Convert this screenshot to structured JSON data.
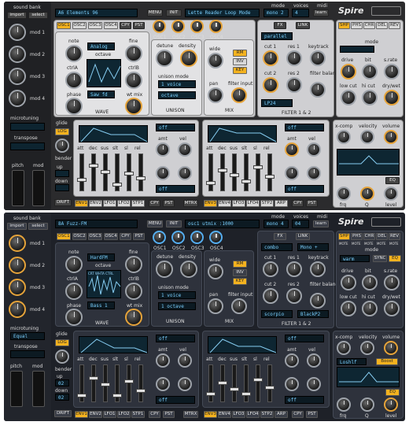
{
  "top": {
    "side": {
      "sound_bank": "sound bank",
      "import": "import",
      "select": "select",
      "mods": [
        "mod 1",
        "mod 2",
        "mod 3",
        "mod 4"
      ],
      "microtuning": "microtuning",
      "transpose": "transpose",
      "pitch": "pitch",
      "mod": "mod"
    },
    "header": {
      "patch": "A6 Elements 96",
      "menu": "MENU",
      "init": "INIT",
      "matrix": "Lette Reader Loop Mode",
      "mode_label": "mode",
      "mode": "mono 2",
      "voices_label": "voices",
      "voices": "4",
      "midi_label": "midi",
      "learn": "learn",
      "logo": "Spire"
    },
    "osc_tabs": [
      "OSC1",
      "OSC2",
      "OSC3",
      "OSC4",
      "CPY",
      "PST"
    ],
    "osc_knobs": [
      "OSC1",
      "OSC2",
      "OSC3",
      "OSC4"
    ],
    "osc": {
      "note": "note",
      "fine": "fine",
      "octave": "octave",
      "ctrl_a": "ctrlA",
      "ctrl_b": "ctrlB",
      "phase": "phase",
      "wt_mix": "wt mix",
      "wave": "WAVE",
      "mode_lcd": "Analog",
      "wave_lcd": "Saw fd"
    },
    "unison": {
      "detune": "detune",
      "density": "density",
      "mode_label": "unison mode",
      "mode": "1 voice",
      "octave": "octave",
      "label": "UNISON"
    },
    "mix": {
      "wide": "wide",
      "rm": "RM",
      "inv": "INV",
      "key": "KEY",
      "pan": "pan",
      "filter_input": "filter input",
      "label": "MIX"
    },
    "filter": {
      "mode_lcd": "parallel",
      "cut1": "cut 1",
      "res1": "res 1",
      "keytrack": "keytrack",
      "cut2": "cut 2",
      "res2": "res 2",
      "balance": "filter balance",
      "lcd2": "LP24",
      "label": "FILTER 1 & 2",
      "fx": "FX",
      "link": "LINK"
    },
    "fx_tabs": [
      "SHP",
      "PHS",
      "CHR",
      "DEL",
      "REV"
    ],
    "fx": {
      "mode": "mode",
      "drive": "drive",
      "bit": "bit",
      "srate": "s.rate",
      "lowcut": "low cut",
      "hicut": "hi cut",
      "drywet": "dry/wet",
      "xcomp": "x-comp",
      "velocity": "velocity",
      "volume": "volume",
      "frq": "frq",
      "q": "Q",
      "level": "level",
      "eq": "EQ"
    },
    "env": {
      "glide": "glide",
      "log": "LOG",
      "bender": "bender",
      "up": "up",
      "down": "down",
      "adsr": [
        "att",
        "dec",
        "sus",
        "slt",
        "sl",
        "rel"
      ],
      "amt": "amt",
      "vel": "vel",
      "off": "off",
      "drift": "DRIFT"
    },
    "tabs_left": [
      "ENV1",
      "ENV2",
      "LFO1",
      "LFO2",
      "STP1",
      "CPY",
      "PST",
      "MTRX"
    ],
    "tabs_right": [
      "ENV3",
      "ENV4",
      "LFO3",
      "LFO4",
      "STP2",
      "ARP",
      "CPY",
      "PST"
    ]
  },
  "bottom": {
    "side": {
      "sound_bank": "sound bank",
      "import": "import",
      "select": "select",
      "mods": [
        "mod 1",
        "mod 2",
        "mod 3",
        "mod 4"
      ],
      "microtuning": "microtuning",
      "micro_val": "Equal",
      "transpose": "transpose",
      "glide": "glide",
      "log": "LOG",
      "bender": "bender",
      "up": "up",
      "down": "down",
      "up_val": "02",
      "down_val": "02",
      "pitch": "pitch",
      "mod": "mod",
      "drift": "DRIFT"
    },
    "header": {
      "patch": "8A Fuzz-FM",
      "menu": "MENU",
      "init": "INIT",
      "matrix": "osc1 utmix :1000",
      "mode_label": "mode",
      "mode": "mono 4",
      "voices_label": "voices",
      "voices": "04",
      "midi_label": "midi",
      "learn": "learn",
      "logo": "Spire"
    },
    "osc_tabs": [
      "OSC1",
      "OSC2",
      "OSC3",
      "OSC4",
      "CPY",
      "PST"
    ],
    "osc_knobs": [
      "OSC1",
      "OSC2",
      "OSC3",
      "OSC4"
    ],
    "osc": {
      "note": "note",
      "fine": "fine",
      "octave": "octave",
      "ctrl_a": "ctrlA",
      "ctrl_b": "ctrlB",
      "phase": "phase",
      "wt_mix": "wt mix",
      "wave": "WAVE",
      "mode_lcd": "HardFM",
      "wave_lcd": "Bass 1",
      "ctrl_head": "CRT  WHTA  CTRL"
    },
    "unison": {
      "detune": "detune",
      "density": "density",
      "mode_label": "unison mode",
      "mode": "1 voice",
      "octave": "1 octave",
      "label": "UNISON"
    },
    "mix": {
      "wide": "wide",
      "rm": "RM",
      "inv": "INV",
      "key": "KEY",
      "pan": "pan",
      "filter_input": "filter input",
      "label": "MIX"
    },
    "filter": {
      "mode_lcd": "combo",
      "mode2": "Mono +",
      "cut1": "cut 1",
      "res1": "res 1",
      "keytrack": "keytrack",
      "cut2": "cut 2",
      "res2": "res 2",
      "balance": "filter balance",
      "lcd2": "scorpio",
      "lcd3": "BlackP2",
      "label": "FILTER 1 & 2",
      "fx": "FX",
      "link": "LINK"
    },
    "fx_tabs": [
      "SHP",
      "PHS",
      "CHR",
      "DEL",
      "REV"
    ],
    "fx_sub": [
      "MOTE",
      "MOTE",
      "MOTE",
      "MOTE",
      "MOTE"
    ],
    "fx": {
      "mode": "mode",
      "mode_lcd": "warm",
      "sync": "SYNC",
      "eq_btn": "EQ",
      "drive": "drive",
      "bit": "bit",
      "srate": "s.rate",
      "lowcut": "low cut",
      "hicut": "hi cut",
      "drywet": "dry/wet",
      "xcomp": "x-comp",
      "velocity": "velocity",
      "volume": "volume",
      "frq": "frq",
      "q": "Q",
      "level": "level",
      "eq": "EQ",
      "lcd_a": "Loshlf",
      "lcd_b": "Boost"
    },
    "env": {
      "adsr": [
        "att",
        "dec",
        "sus",
        "slt",
        "sl",
        "rel"
      ],
      "amt": "amt",
      "vel": "vel",
      "off": "off"
    },
    "tabs_left": [
      "ENV1",
      "ENV2",
      "LFO1",
      "LFO2",
      "STP1",
      "CPY",
      "PST",
      "MTRX"
    ],
    "tabs_right": [
      "ENV3",
      "ENV4",
      "LFO3",
      "LFO4",
      "STP2",
      "ARP",
      "CPY",
      "PST"
    ]
  }
}
